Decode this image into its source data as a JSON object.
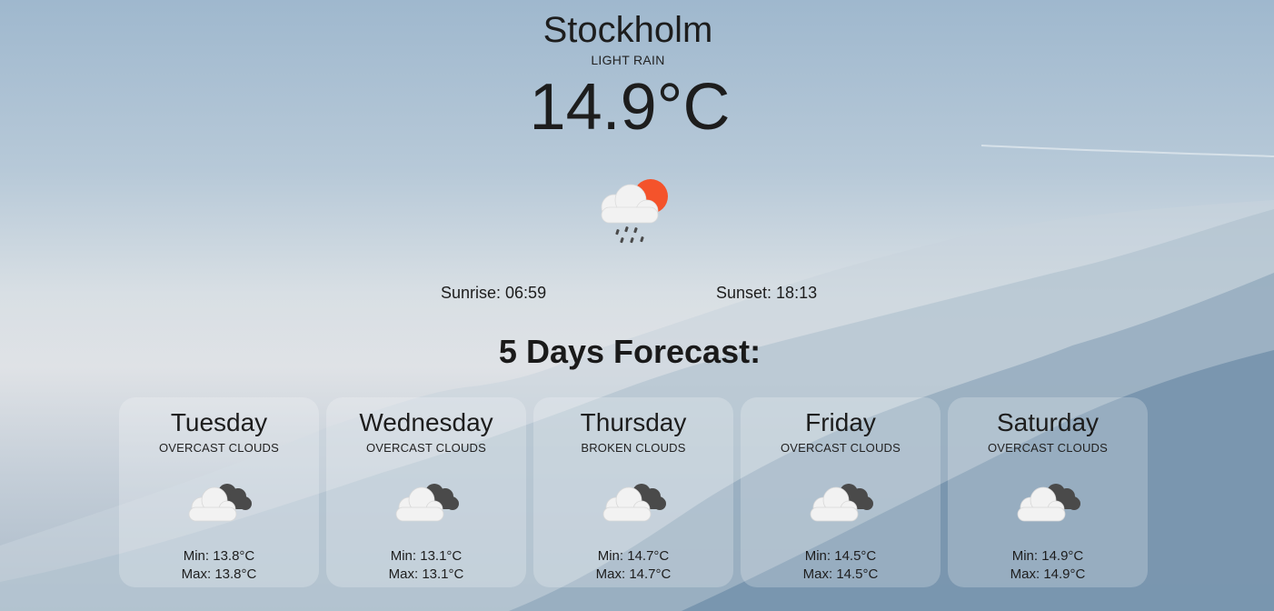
{
  "current": {
    "city": "Stockholm",
    "description": "LIGHT RAIN",
    "temperature": "14.9°C",
    "icon": "light-rain-sun-icon",
    "sunrise": "Sunrise: 06:59",
    "sunset": "Sunset: 18:13"
  },
  "forecast": {
    "title": "5 Days Forecast:",
    "days": [
      {
        "day": "Tuesday",
        "description": "OVERCAST CLOUDS",
        "icon": "overcast-clouds-icon",
        "min": "Min: 13.8°C",
        "max": "Max: 13.8°C"
      },
      {
        "day": "Wednesday",
        "description": "OVERCAST CLOUDS",
        "icon": "overcast-clouds-icon",
        "min": "Min: 13.1°C",
        "max": "Max: 13.1°C"
      },
      {
        "day": "Thursday",
        "description": "BROKEN CLOUDS",
        "icon": "broken-clouds-icon",
        "min": "Min: 14.7°C",
        "max": "Max: 14.7°C"
      },
      {
        "day": "Friday",
        "description": "OVERCAST CLOUDS",
        "icon": "overcast-clouds-icon",
        "min": "Min: 14.5°C",
        "max": "Max: 14.5°C"
      },
      {
        "day": "Saturday",
        "description": "OVERCAST CLOUDS",
        "icon": "overcast-clouds-icon",
        "min": "Min: 14.9°C",
        "max": "Max: 14.9°C"
      }
    ]
  },
  "colors": {
    "sun": "#f4532b",
    "cloud_light": "#f2f2f2",
    "cloud_dark": "#4a4a4a",
    "rain": "#4a4a4a"
  }
}
